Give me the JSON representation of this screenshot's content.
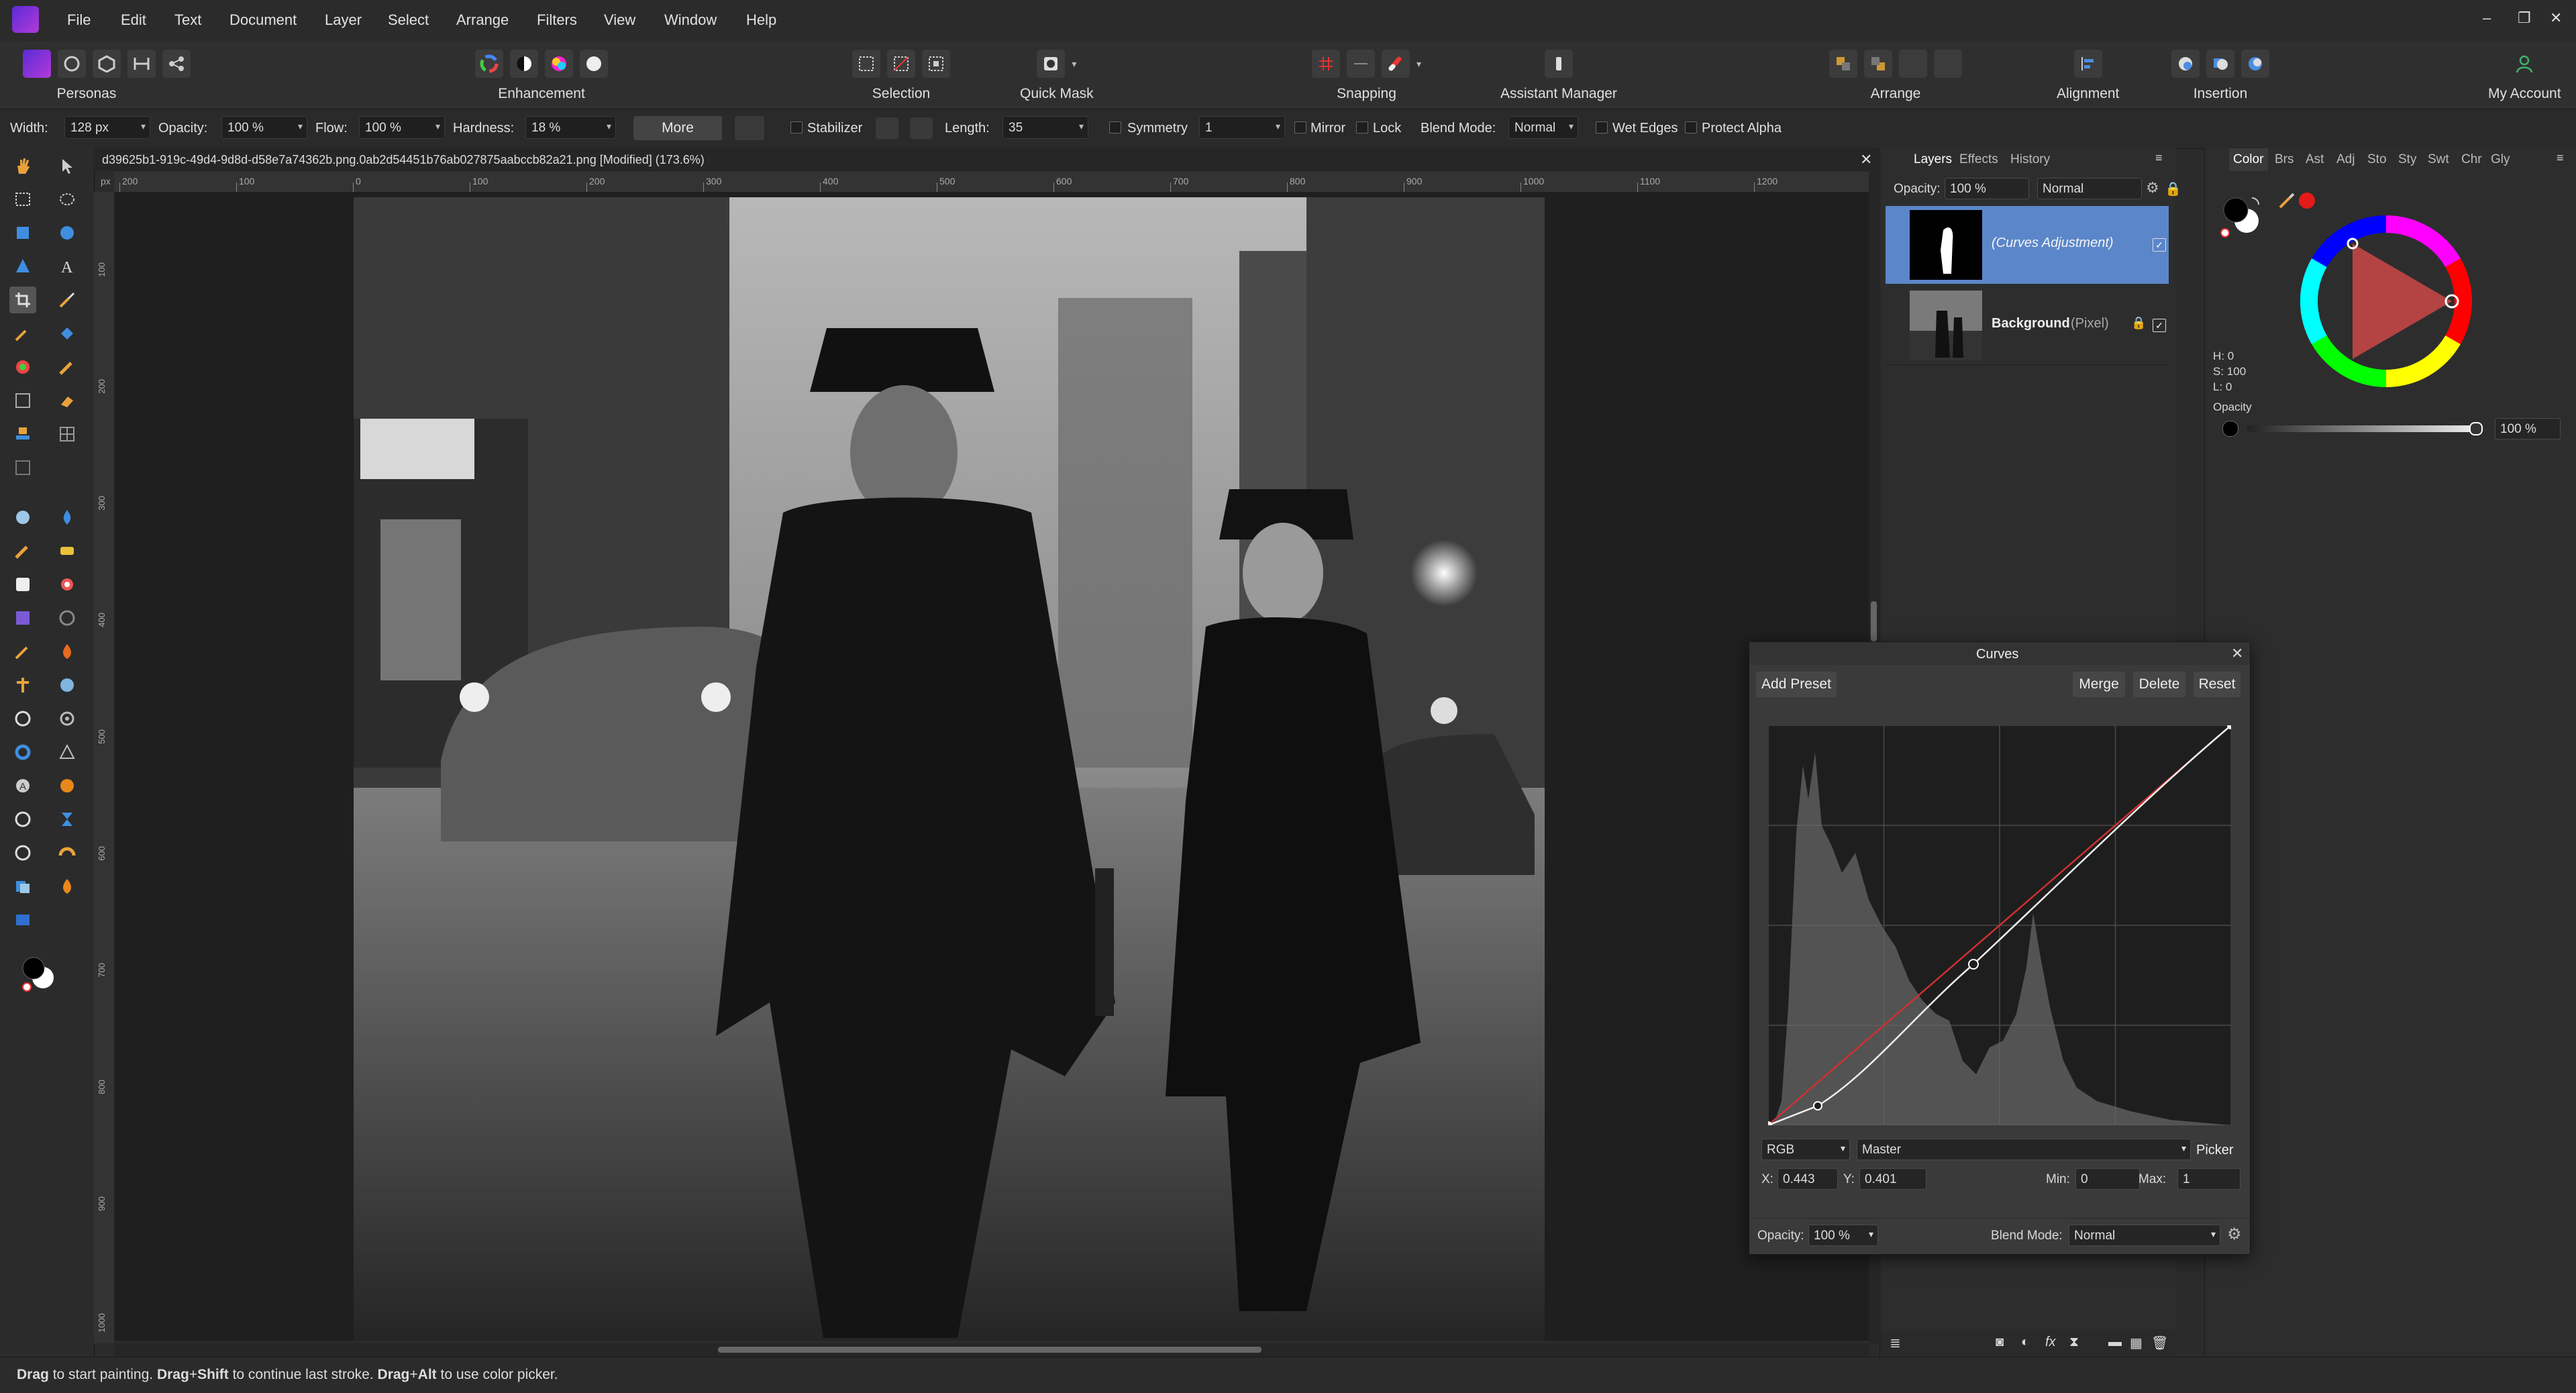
{
  "menu": {
    "items": [
      "File",
      "Edit",
      "Text",
      "Document",
      "Layer",
      "Select",
      "Arrange",
      "Filters",
      "View",
      "Window",
      "Help"
    ],
    "window_controls": [
      "–",
      "❐",
      "✕"
    ]
  },
  "toolbar": {
    "personas": "Personas",
    "enhancement": "Enhancement",
    "selection": "Selection",
    "quick_mask": "Quick Mask",
    "snapping": "Snapping",
    "assistant_manager": "Assistant Manager",
    "arrange": "Arrange",
    "alignment": "Alignment",
    "insertion": "Insertion",
    "my_account": "My Account"
  },
  "context": {
    "width_label": "Width:",
    "width_value": "128 px",
    "opacity_label": "Opacity:",
    "opacity_value": "100 %",
    "flow_label": "Flow:",
    "flow_value": "100 %",
    "hardness_label": "Hardness:",
    "hardness_value": "18 %",
    "more_label": "More",
    "stabilizer_label": "Stabilizer",
    "length_label": "Length:",
    "length_value": "35",
    "symmetry_label": "Symmetry",
    "symmetry_value": "1",
    "mirror_label": "Mirror",
    "lock_label": "Lock",
    "blend_label": "Blend Mode:",
    "blend_value": "Normal",
    "wet_edges_label": "Wet Edges",
    "protect_alpha_label": "Protect Alpha"
  },
  "document": {
    "tab_title": "d39625b1-919c-49d4-9d8d-d58e7a74362b.png.0ab2d54451b76ab027875aabccb82a21.png [Modified] (173.6%)",
    "ruler_unit": "px",
    "ruler_top_ticks": [
      "200",
      "100",
      "0",
      "100",
      "200",
      "300",
      "400",
      "500",
      "600",
      "700",
      "800",
      "900",
      "1000",
      "1100",
      "1200"
    ],
    "ruler_left_ticks": [
      "100",
      "200",
      "300",
      "400",
      "500",
      "600",
      "700",
      "800",
      "900",
      "1000"
    ]
  },
  "layers_panel": {
    "tabs": [
      "Layers",
      "Effects",
      "History"
    ],
    "opacity_label": "Opacity:",
    "opacity_value": "100 %",
    "blend_value": "Normal",
    "layers": [
      {
        "name": "",
        "type": "(Curves Adjustment)"
      },
      {
        "name": "Background",
        "type": "(Pixel)"
      }
    ]
  },
  "color_panel": {
    "tabs": [
      "Color",
      "Brs",
      "Ast",
      "Adj",
      "Sto",
      "Sty",
      "Swt",
      "Chr",
      "Gly"
    ],
    "h": "H: 0",
    "s": "S: 100",
    "l": "L: 0",
    "opacity_label": "Opacity",
    "opacity_value": "100 %"
  },
  "curves": {
    "title": "Curves",
    "add_preset": "Add Preset",
    "merge": "Merge",
    "delete": "Delete",
    "reset": "Reset",
    "colour_space": "RGB",
    "channel": "Master",
    "picker": "Picker",
    "x_label": "X:",
    "x_value": "0.443",
    "y_label": "Y:",
    "y_value": "0.401",
    "min_label": "Min:",
    "min_value": "0",
    "max_label": "Max:",
    "max_value": "1",
    "opacity_label": "Opacity:",
    "opacity_value": "100 %",
    "blend_label": "Blend Mode:",
    "blend_value": "Normal"
  },
  "status": {
    "b1": "Drag",
    "t1": " to start painting. ",
    "b2": "Drag",
    "t2": "+",
    "b3": "Shift",
    "t3": " to continue last stroke. ",
    "b4": "Drag",
    "t4": "+",
    "b5": "Alt",
    "t5": " to use color picker."
  },
  "colors": {
    "accent": "#5b86c9",
    "curve_red": "#d03030",
    "wheel_marker": "#ff2020"
  }
}
